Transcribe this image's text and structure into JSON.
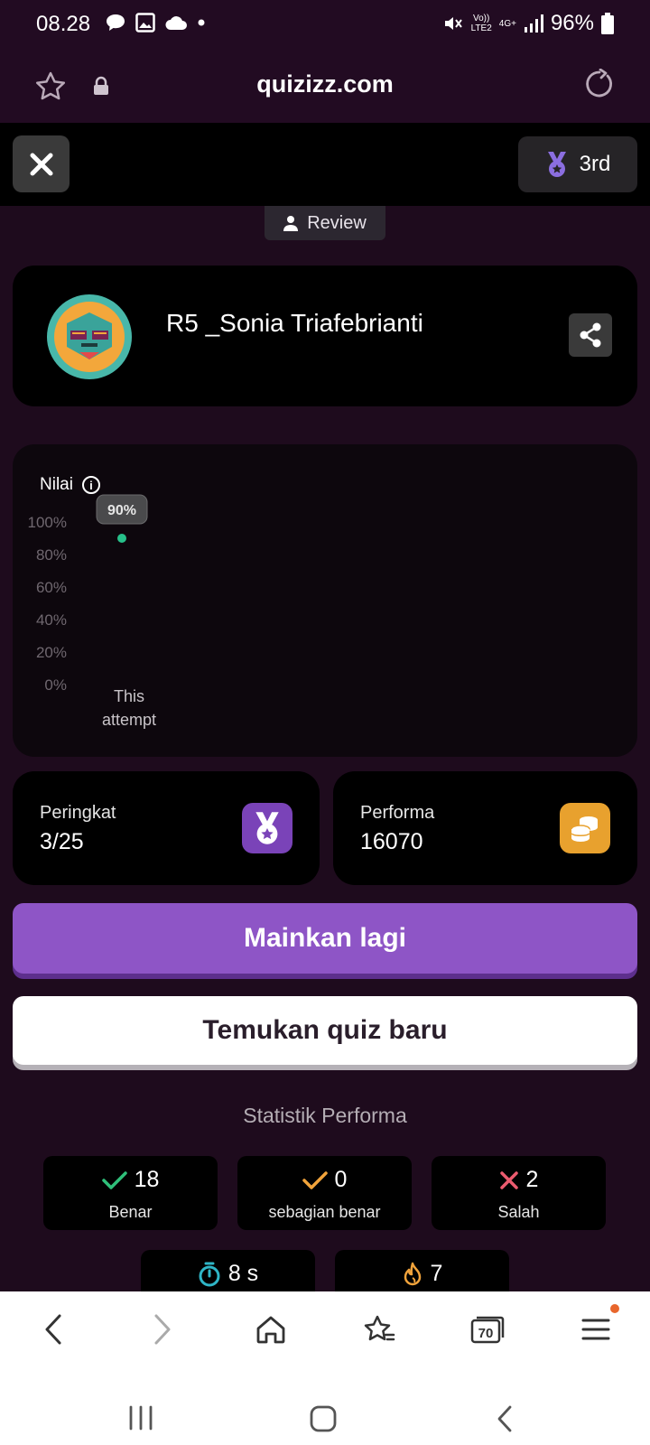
{
  "status_bar": {
    "time": "08.28",
    "network_top": "Vo))",
    "network_bottom": "LTE2",
    "network_type": "4G+",
    "battery": "96%"
  },
  "browser": {
    "url": "quizizz.com"
  },
  "game_header": {
    "rank_badge": "3rd",
    "review_label": "Review"
  },
  "player": {
    "name": "R5 _Sonia Triafebrianti"
  },
  "chart_data": {
    "type": "scatter",
    "title": "Nilai",
    "categories": [
      "This attempt"
    ],
    "category_label_lines": [
      "This",
      "attempt"
    ],
    "values": [
      90
    ],
    "data_labels": [
      "90%"
    ],
    "y_ticks": [
      "100%",
      "80%",
      "60%",
      "40%",
      "20%",
      "0%"
    ],
    "ylim": [
      0,
      100
    ],
    "point_color": "#27c08a",
    "grid": false
  },
  "summary": {
    "rank_label": "Peringkat",
    "rank_value": "3/25",
    "performance_label": "Performa",
    "performance_value": "16070"
  },
  "buttons": {
    "play_again": "Mainkan lagi",
    "find_quiz": "Temukan quiz baru"
  },
  "stats": {
    "heading": "Statistik Performa",
    "correct_value": "18",
    "correct_label": "Benar",
    "partial_value": "0",
    "partial_label": "sebagian benar",
    "wrong_value": "2",
    "wrong_label": "Salah",
    "time_value": "8 s",
    "streak_value": "7"
  },
  "bottom_nav": {
    "tab_count": "70"
  },
  "colors": {
    "accent_purple": "#8e55c6",
    "correct_green": "#2fbf7a",
    "partial_orange": "#f1a33b",
    "wrong_red": "#ec5b6f",
    "timer_teal": "#2fb6c7"
  }
}
